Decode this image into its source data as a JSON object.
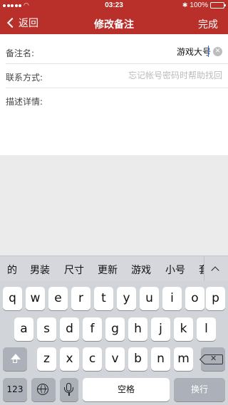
{
  "status_bar": {
    "time": "03:23",
    "battery_label": "100%"
  },
  "nav": {
    "back_label": "返回",
    "title": "修改备注",
    "done_label": "完成"
  },
  "form": {
    "name_label": "备注名:",
    "name_value": "游戏大号",
    "contact_label": "联系方式:",
    "contact_placeholder": "忘记帐号密码时帮助找回",
    "details_label": "描述详情:"
  },
  "suggestions": [
    "的",
    "男装",
    "尺寸",
    "更新",
    "游戏",
    "小号",
    "套"
  ],
  "keyboard": {
    "row1": [
      "q",
      "w",
      "e",
      "r",
      "t",
      "y",
      "u",
      "i",
      "o",
      "p"
    ],
    "row2": [
      "a",
      "s",
      "d",
      "f",
      "g",
      "h",
      "j",
      "k",
      "l"
    ],
    "row3": [
      "z",
      "x",
      "c",
      "v",
      "b",
      "n",
      "m"
    ],
    "numbers_label": "123",
    "space_label": "空格",
    "enter_label": "换行"
  },
  "colors": {
    "brand": "#b9302b",
    "keyboard_bg": "#d1d4d9"
  }
}
